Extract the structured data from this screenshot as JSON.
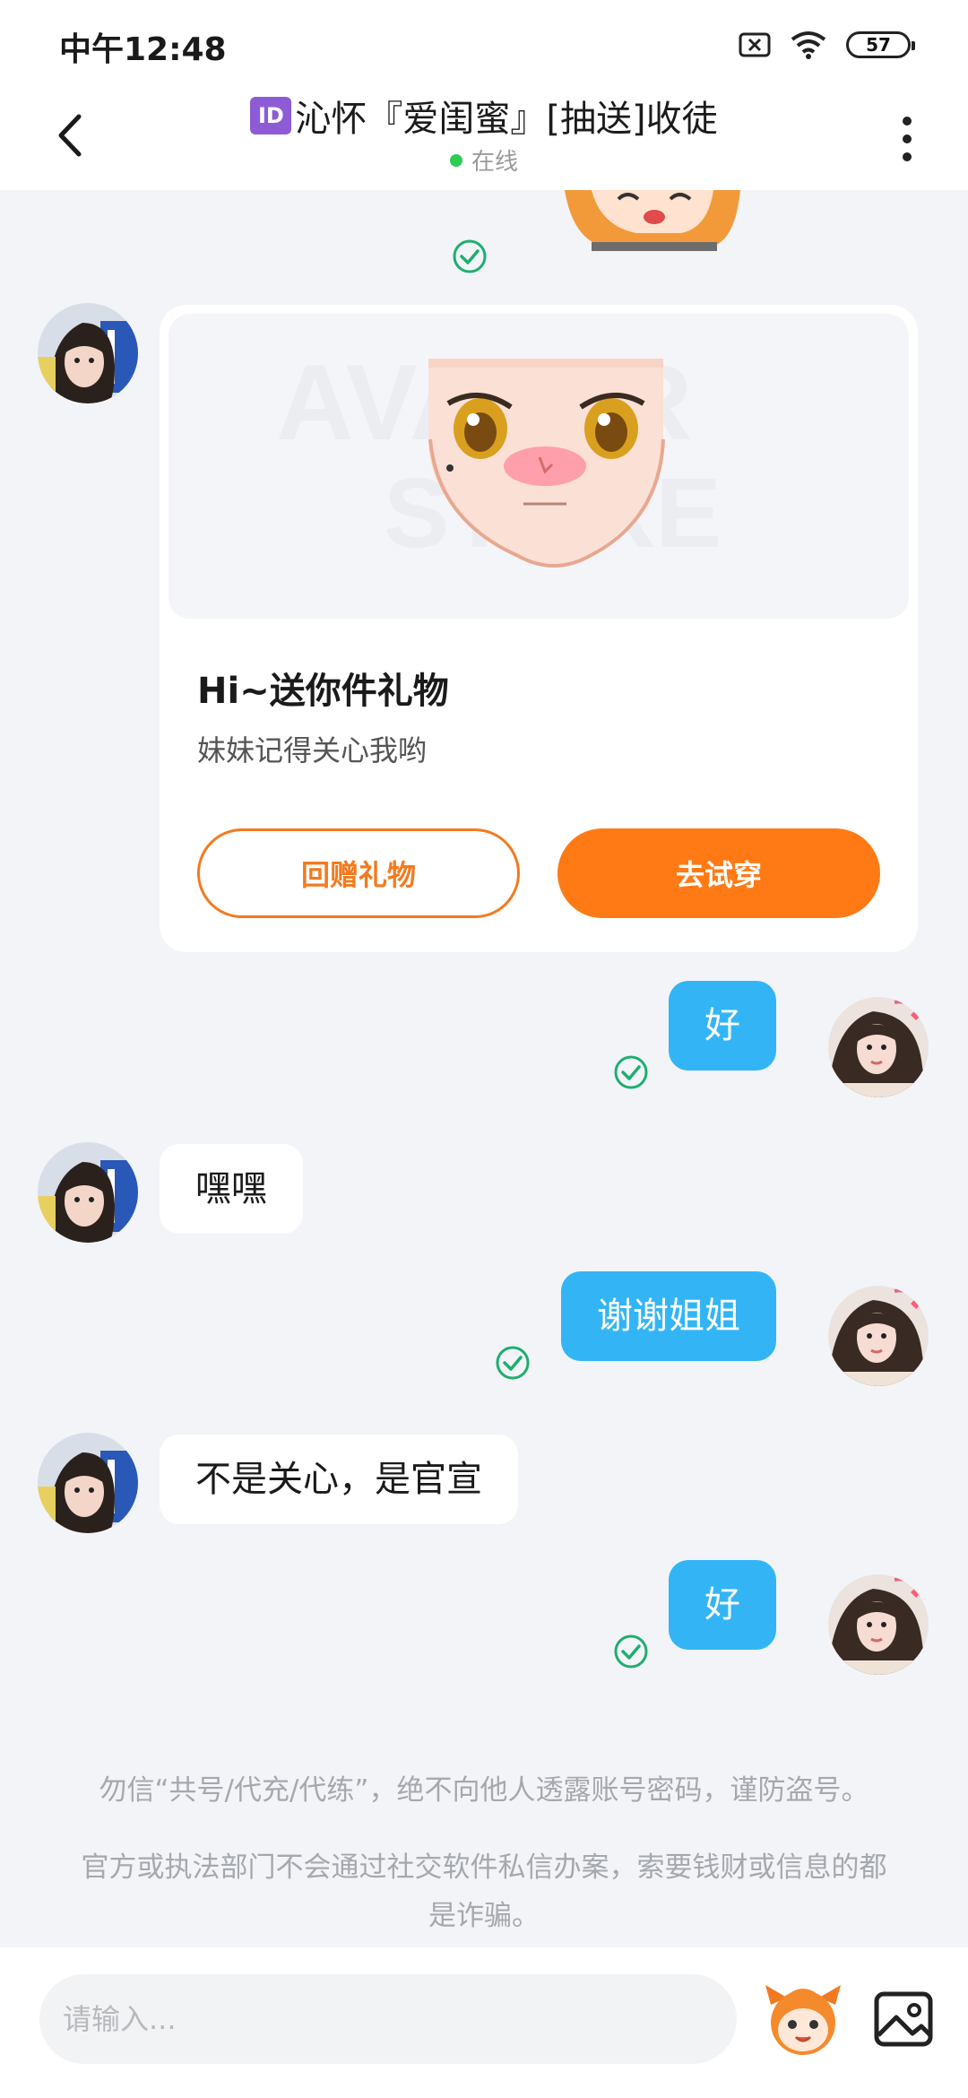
{
  "status_bar": {
    "time": "中午12:48",
    "battery": "57",
    "icons": [
      "sim-off-icon",
      "wifi-icon",
      "battery-icon"
    ]
  },
  "header": {
    "id_badge": "ID",
    "title": "沁怀『爱闺蜜』[抽送]收徒",
    "status": "在线"
  },
  "gift_card": {
    "title": "Hi~送你件礼物",
    "subtitle": "妹妹记得关心我哟",
    "watermark": "AVATAR STORE",
    "return_gift_button": "回赠礼物",
    "try_on_button": "去试穿"
  },
  "messages": [
    {
      "side": "out",
      "text": "好"
    },
    {
      "side": "in",
      "text": "嘿嘿"
    },
    {
      "side": "out",
      "text": "谢谢姐姐"
    },
    {
      "side": "in",
      "text": "不是关心，是官宣"
    },
    {
      "side": "out",
      "text": "好"
    }
  ],
  "notices": {
    "line1": "勿信“共号/代充/代练”，绝不向他人透露账号密码，谨防盗号。",
    "line2": "官方或执法部门不会通过社交软件私信办案，索要钱财或信息的都是诈骗。"
  },
  "input": {
    "placeholder": "请输入..."
  },
  "colors": {
    "accent_orange": "#ff7a14",
    "outgoing_bubble": "#33b5f5",
    "read_check": "#1fae6f",
    "online": "#2ecc55"
  }
}
